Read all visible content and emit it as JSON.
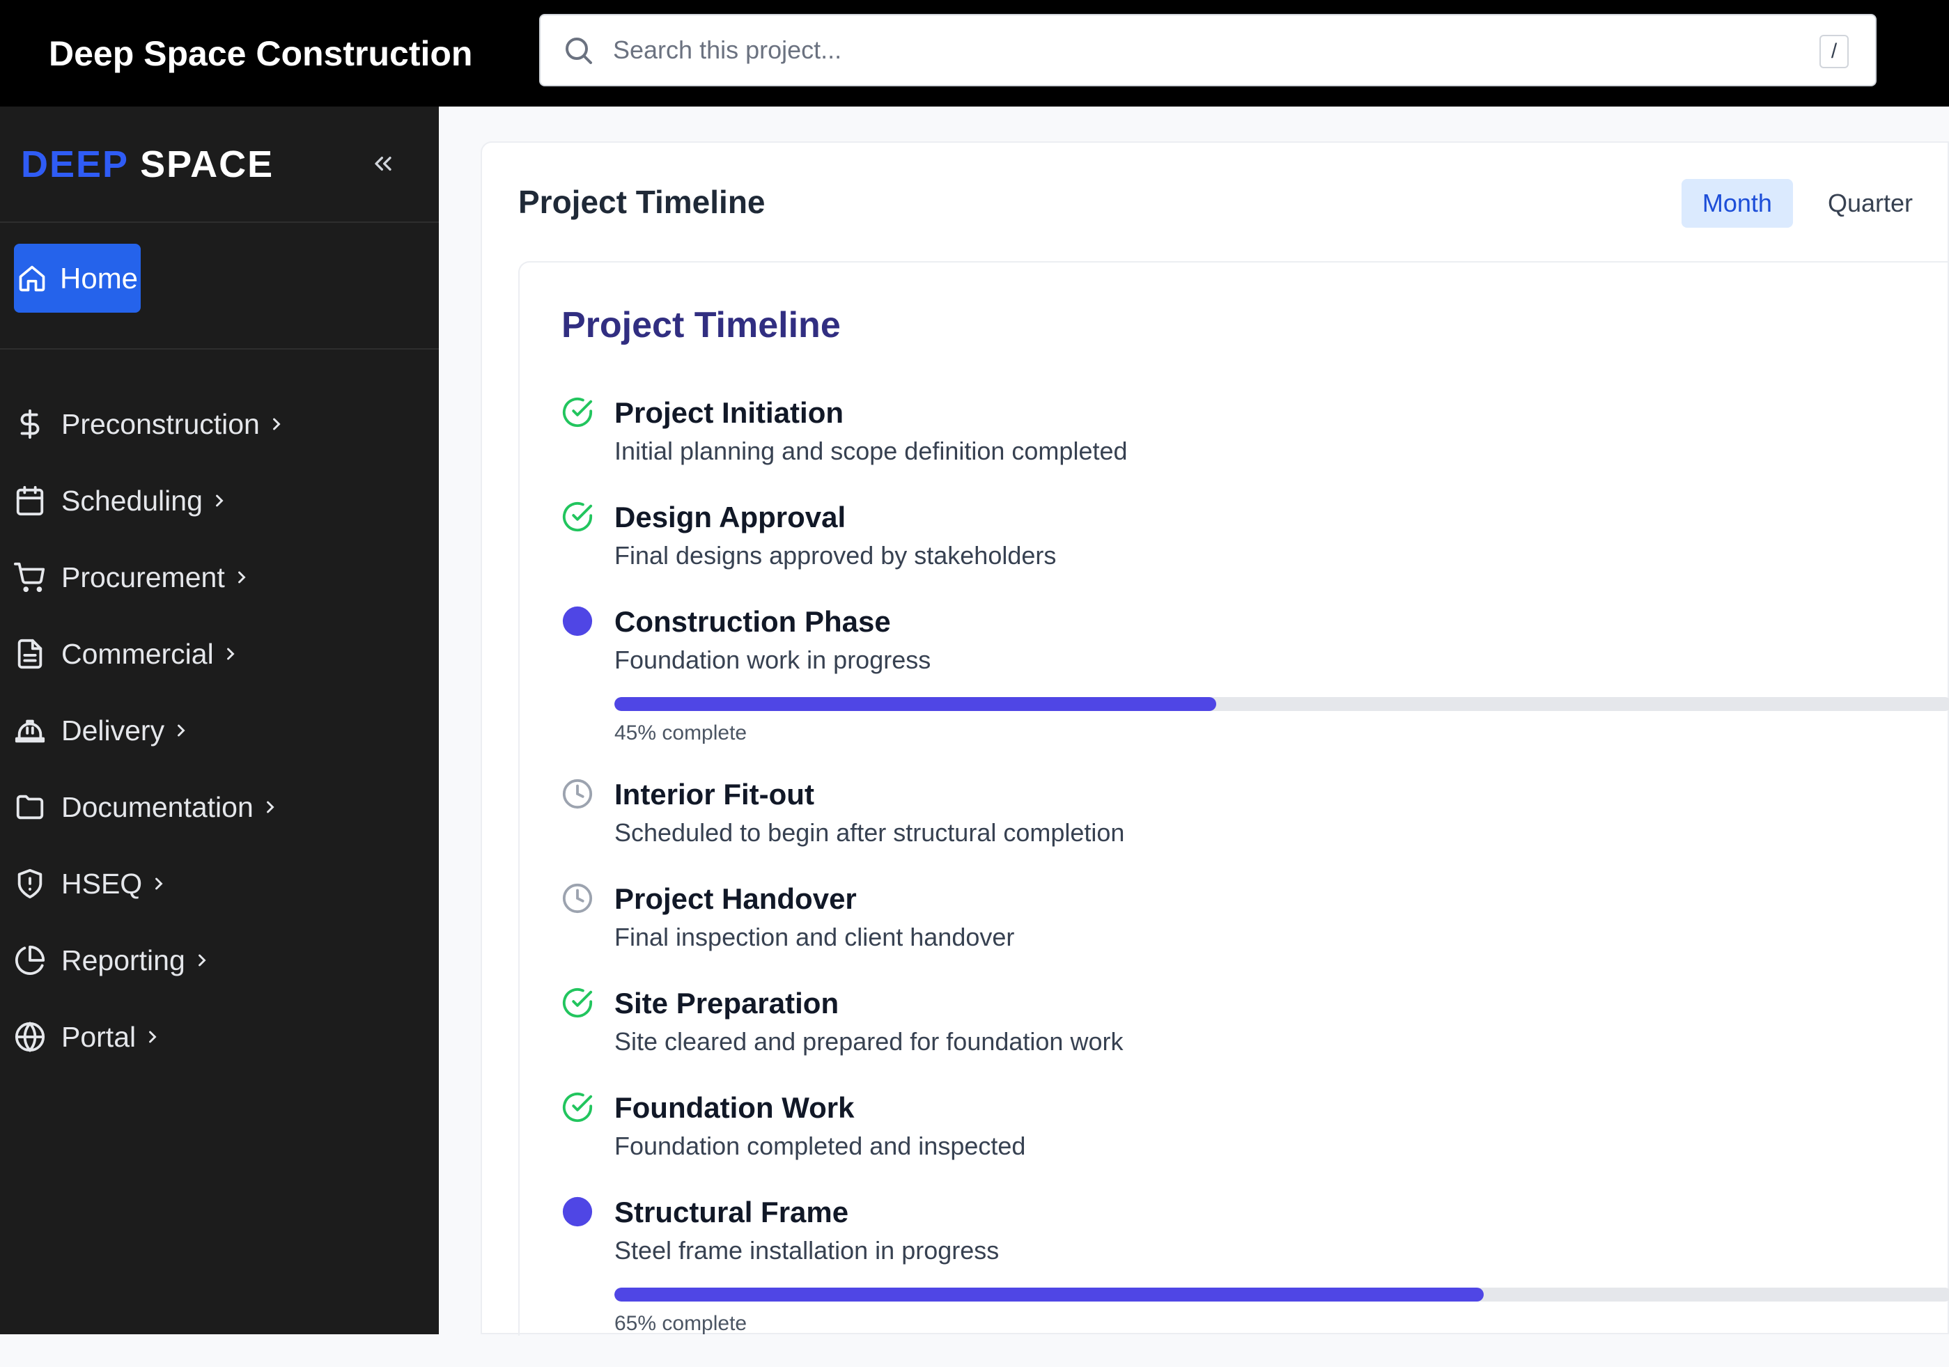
{
  "topbar": {
    "title": "Deep Space Construction",
    "search_placeholder": "Search this project...",
    "shortcut": "/"
  },
  "sidebar": {
    "logo_part1": "DEEP",
    "logo_part2": "SPACE",
    "home_label": "Home",
    "items": [
      {
        "label": "Preconstruction",
        "icon": "dollar-icon"
      },
      {
        "label": "Scheduling",
        "icon": "calendar-icon"
      },
      {
        "label": "Procurement",
        "icon": "cart-icon"
      },
      {
        "label": "Commercial",
        "icon": "document-icon"
      },
      {
        "label": "Delivery",
        "icon": "hardhat-icon"
      },
      {
        "label": "Documentation",
        "icon": "folder-icon"
      },
      {
        "label": "HSEQ",
        "icon": "shield-icon"
      },
      {
        "label": "Reporting",
        "icon": "pie-chart-icon"
      },
      {
        "label": "Portal",
        "icon": "globe-icon"
      }
    ]
  },
  "main": {
    "title": "Project Timeline",
    "toggle": {
      "month": "Month",
      "quarter": "Quarter",
      "active": "month"
    },
    "timeline_title": "Project Timeline",
    "items": [
      {
        "title": "Project Initiation",
        "desc": "Initial planning and scope definition completed",
        "status": "complete"
      },
      {
        "title": "Design Approval",
        "desc": "Final designs approved by stakeholders",
        "status": "complete"
      },
      {
        "title": "Construction Phase",
        "desc": "Foundation work in progress",
        "status": "in-progress",
        "progress": 45,
        "progress_label": "45% complete"
      },
      {
        "title": "Interior Fit-out",
        "desc": "Scheduled to begin after structural completion",
        "status": "scheduled"
      },
      {
        "title": "Project Handover",
        "desc": "Final inspection and client handover",
        "status": "scheduled"
      },
      {
        "title": "Site Preparation",
        "desc": "Site cleared and prepared for foundation work",
        "status": "complete"
      },
      {
        "title": "Foundation Work",
        "desc": "Foundation completed and inspected",
        "status": "complete"
      },
      {
        "title": "Structural Frame",
        "desc": "Steel frame installation in progress",
        "status": "in-progress",
        "progress": 65,
        "progress_label": "65% complete"
      }
    ]
  },
  "colors": {
    "accent": "#2563eb",
    "progress": "#4f46e5",
    "complete": "#22c55e",
    "scheduled": "#9ca3af",
    "timeline_title": "#312e81"
  }
}
